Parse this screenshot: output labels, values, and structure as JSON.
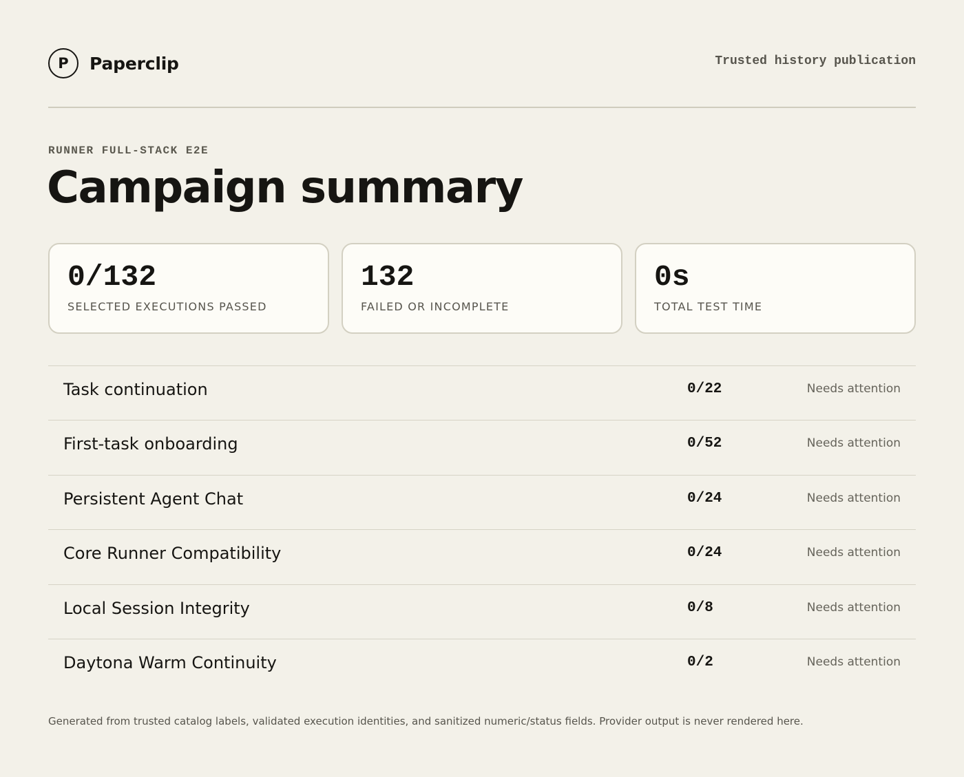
{
  "header": {
    "logo_letter": "P",
    "brand_name": "Paperclip",
    "tagline": "Trusted history publication"
  },
  "main": {
    "eyebrow": "RUNNER FULL-STACK E2E",
    "title": "Campaign summary",
    "stats": [
      {
        "value": "0/132",
        "label": "SELECTED EXECUTIONS PASSED"
      },
      {
        "value": "132",
        "label": "FAILED OR INCOMPLETE"
      },
      {
        "value": "0s",
        "label": "TOTAL TEST TIME"
      }
    ],
    "suites": [
      {
        "name": "Task continuation",
        "count": "0/22",
        "status": "Needs attention"
      },
      {
        "name": "First-task onboarding",
        "count": "0/52",
        "status": "Needs attention"
      },
      {
        "name": "Persistent Agent Chat",
        "count": "0/24",
        "status": "Needs attention"
      },
      {
        "name": "Core Runner Compatibility",
        "count": "0/24",
        "status": "Needs attention"
      },
      {
        "name": "Local Session Integrity",
        "count": "0/8",
        "status": "Needs attention"
      },
      {
        "name": "Daytona Warm Continuity",
        "count": "0/2",
        "status": "Needs attention"
      }
    ],
    "footnote": "Generated from trusted catalog labels, validated execution identities, and sanitized numeric/status fields. Provider output is never rendered here."
  }
}
